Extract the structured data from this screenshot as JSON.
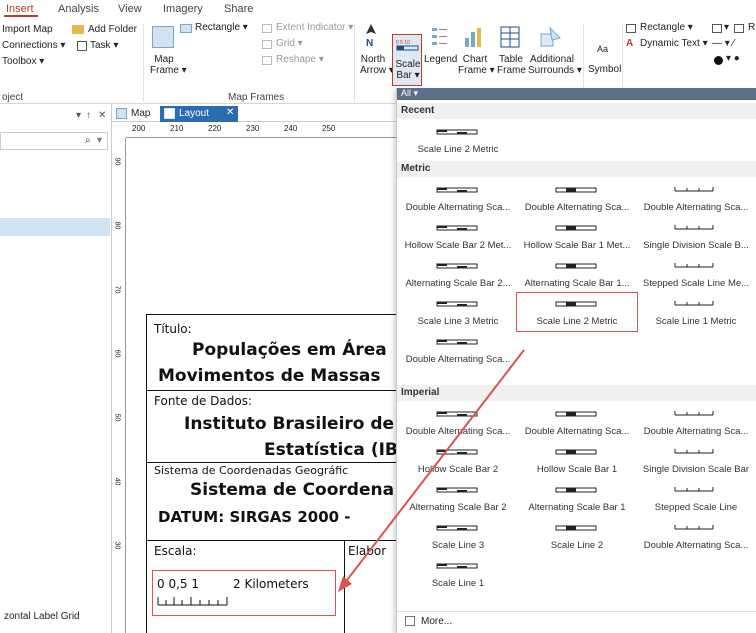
{
  "tabs": [
    "Insert",
    "Analysis",
    "View",
    "Imagery",
    "Share"
  ],
  "ribbon": {
    "project": {
      "import_map": "Import Map",
      "add_folder": "Add Folder",
      "connections": "Connections",
      "task": "Task",
      "toolbox": "Toolbox",
      "group": "oject"
    },
    "map_frame": {
      "rectangle": "Rectangle",
      "map": "Map",
      "frame": "Frame",
      "extent_indicator": "Extent Indicator",
      "grid": "Grid",
      "reshape": "Reshape",
      "group": "Map Frames"
    },
    "surrounds": {
      "north": "North",
      "arrow": "Arrow",
      "scale": "Scale",
      "bar": "Bar",
      "legend": "Legend",
      "chart": "Chart",
      "chart2": "Frame",
      "table": "Table",
      "table2": "Frame",
      "additional": "Additional",
      "additional2": "Surrounds"
    },
    "graphics": {
      "symbol": "Symbol",
      "aa": "Aa",
      "rectangle": "Rectangle",
      "dynamic_text": "Dynamic Text",
      "rect_short": "R"
    }
  },
  "doc_tabs": {
    "map": "Map",
    "layout": "Layout"
  },
  "left": {
    "search_icon": "search",
    "bottom_text": "zontal Label Grid",
    "pin": "↑",
    "close": "✕"
  },
  "ruler": {
    "labels": [
      "200",
      "210",
      "220",
      "230",
      "240",
      "250"
    ],
    "vlabels": [
      "90",
      "80",
      "70",
      "60",
      "50",
      "40",
      "30"
    ]
  },
  "layout": {
    "titulo_label": "Título:",
    "title1": "Populações em Área",
    "title2": "Movimentos de Massas",
    "fonte_label": "Fonte de Dados:",
    "fonte1": "Instituto Brasileiro de",
    "fonte2": "Estatística (IB",
    "sistema_label": "Sistema de Coordenadas Geográfic",
    "sistema1": "Sistema de Coordena",
    "datum": "DATUM: SIRGAS 2000 -",
    "escala_label": "Escala:",
    "elabor_label": "Elabor",
    "scale_text1": "0 0,5 1",
    "scale_text2": "2 Kilometers"
  },
  "gallery": {
    "filter": "All",
    "sections": {
      "recent": "Recent",
      "metric": "Metric",
      "imperial": "Imperial"
    },
    "recent": [
      {
        "label": "Scale Line 2 Metric"
      }
    ],
    "metric": [
      {
        "label": "Double Alternating Sca..."
      },
      {
        "label": "Double Alternating Sca..."
      },
      {
        "label": "Double Alternating Sca..."
      },
      {
        "label": "Hollow Scale Bar 2 Met..."
      },
      {
        "label": "Hollow Scale Bar 1 Met..."
      },
      {
        "label": "Single Division Scale B..."
      },
      {
        "label": "Alternating Scale Bar 2..."
      },
      {
        "label": "Alternating Scale Bar 1..."
      },
      {
        "label": "Stepped Scale Line Me..."
      },
      {
        "label": "Scale Line 3 Metric"
      },
      {
        "label": "Scale Line 2 Metric"
      },
      {
        "label": "Scale Line 1 Metric"
      },
      {
        "label": "Double Alternating Sca..."
      }
    ],
    "imperial": [
      {
        "label": "Double Alternating Sca..."
      },
      {
        "label": "Double Alternating Sca..."
      },
      {
        "label": "Double Alternating Sca..."
      },
      {
        "label": "Hollow Scale Bar 2"
      },
      {
        "label": "Hollow Scale Bar 1"
      },
      {
        "label": "Single Division Scale Bar"
      },
      {
        "label": "Alternating Scale Bar 2"
      },
      {
        "label": "Alternating Scale Bar 1"
      },
      {
        "label": "Stepped Scale Line"
      },
      {
        "label": "Scale Line 3"
      },
      {
        "label": "Scale Line 2"
      },
      {
        "label": "Double Alternating Sca..."
      },
      {
        "label": "Scale Line 1"
      }
    ],
    "more": "More..."
  },
  "colors": {
    "accent": "#c0392b",
    "highlight": "#d9534f",
    "arrow": "#d9534f"
  }
}
